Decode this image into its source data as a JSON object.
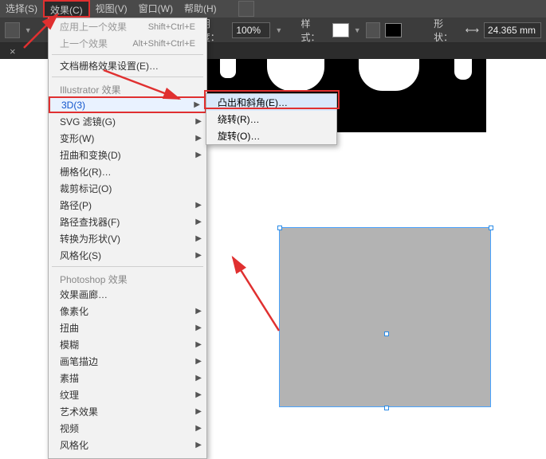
{
  "menubar": {
    "select": "选择(S)",
    "effects": "效果(C)",
    "view": "视图(V)",
    "window": "窗口(W)",
    "help": "帮助(H)"
  },
  "options": {
    "opacity_label": "明度：",
    "opacity_value": "100%",
    "style_label": "样式：",
    "shape_label": "形状：",
    "shape_value": "24.365 mm"
  },
  "dropdown": {
    "apply_last": "应用上一个效果",
    "apply_last_key": "Shift+Ctrl+E",
    "last_effect": "上一个效果",
    "last_effect_key": "Alt+Shift+Ctrl+E",
    "raster_settings": "文档栅格效果设置(E)…",
    "section_ai": "Illustrator 效果",
    "three_d": "3D(3)",
    "svg_filter": "SVG 滤镜(G)",
    "warp": "变形(W)",
    "distort": "扭曲和变换(D)",
    "rasterize": "栅格化(R)…",
    "crop_marks": "裁剪标记(O)",
    "path": "路径(P)",
    "pathfinder": "路径查找器(F)",
    "convert_shape": "转换为形状(V)",
    "stylize": "风格化(S)",
    "section_ps": "Photoshop 效果",
    "fx_gallery": "效果画廊…",
    "pixelate": "像素化",
    "distort2": "扭曲",
    "blur": "模糊",
    "brush": "画笔描边",
    "sketch": "素描",
    "texture": "纹理",
    "artistic": "艺术效果",
    "video": "视频",
    "stylize2": "风格化"
  },
  "submenu_3d": {
    "extrude": "凸出和斜角(E)…",
    "revolve": "绕转(R)…",
    "rotate": "旋转(O)…"
  },
  "tab": {
    "close": "×"
  }
}
